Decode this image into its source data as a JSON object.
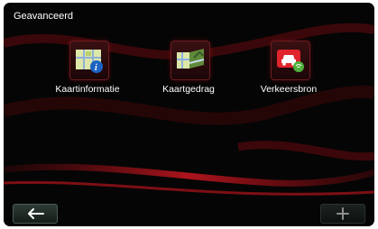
{
  "header": {
    "title": "Geavanceerd"
  },
  "menu": {
    "items": [
      {
        "label": "Kaartinformatie",
        "icon": "map-info-icon"
      },
      {
        "label": "Kaartgedrag",
        "icon": "map-behavior-icon"
      },
      {
        "label": "Verkeersbron",
        "icon": "traffic-source-icon"
      }
    ]
  },
  "bottom_bar": {
    "back_icon": "back-arrow-icon",
    "add_icon": "plus-icon"
  },
  "colors": {
    "background": "#050505",
    "accent_red": "#c0161f",
    "text": "#ffffff"
  }
}
